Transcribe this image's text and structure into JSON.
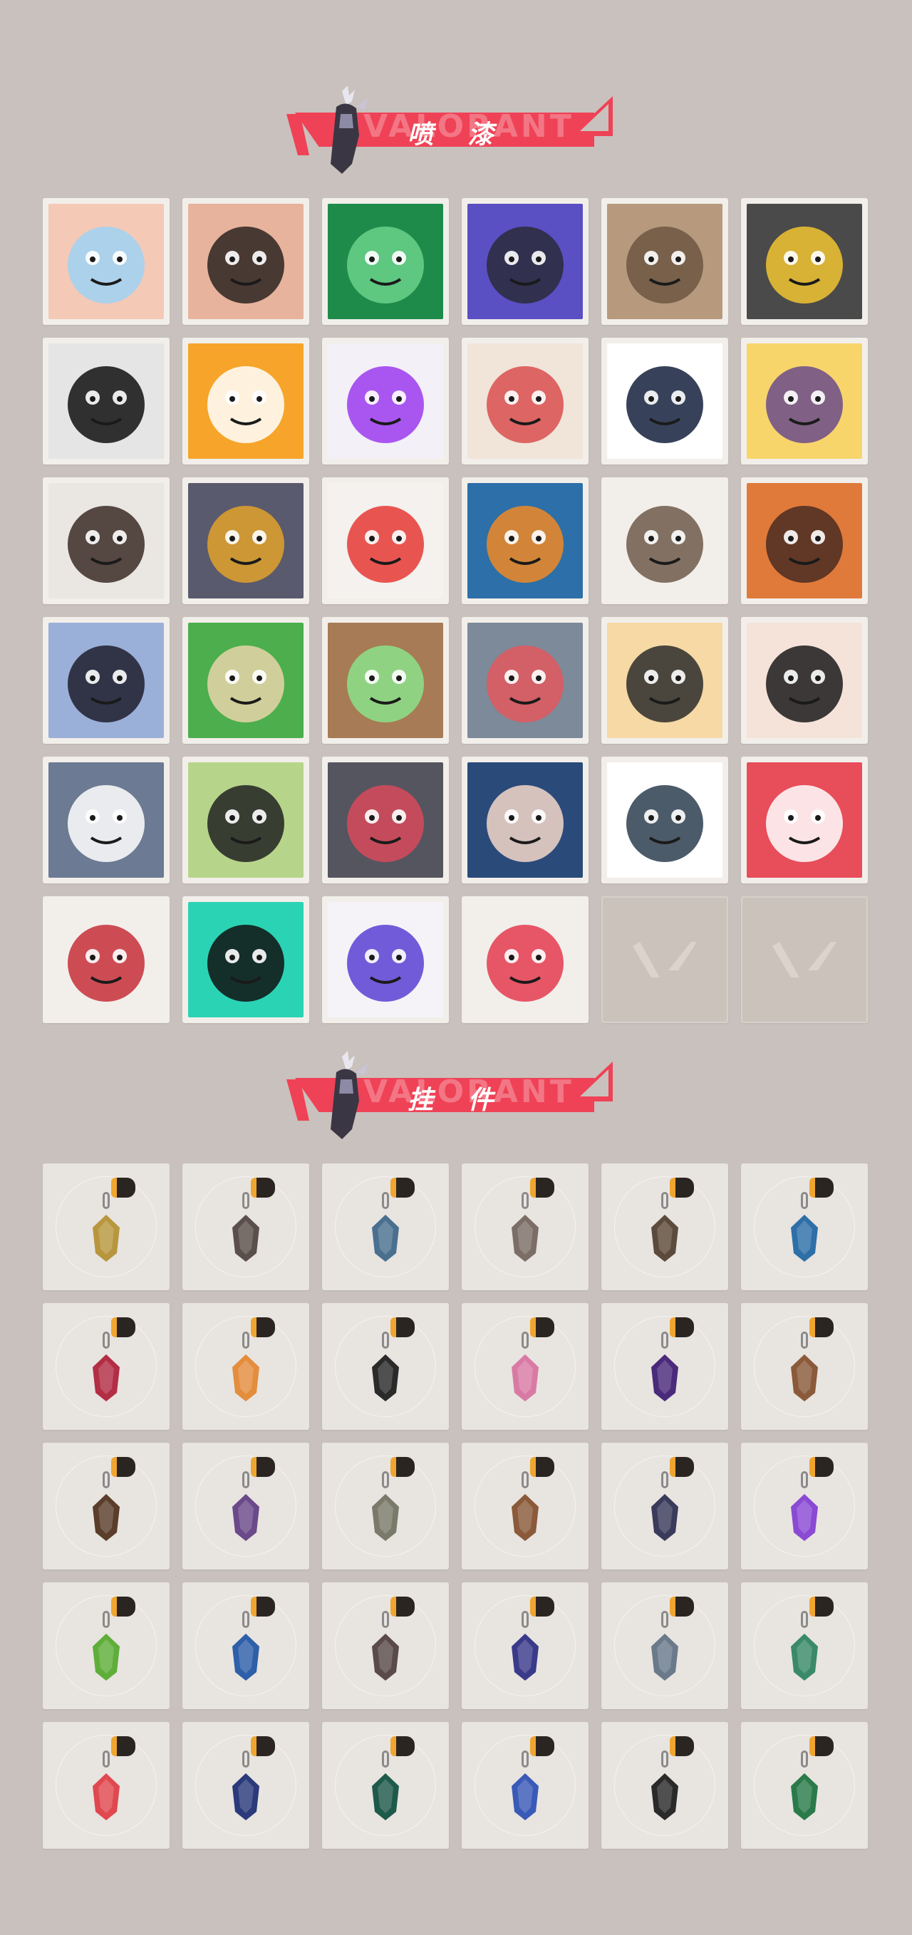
{
  "sections": {
    "sprays": {
      "title": "喷 漆",
      "watermark": "VALORANT"
    },
    "charms": {
      "title": "挂 件",
      "watermark": "VALORANT"
    }
  },
  "spray_tiles": [
    {
      "name": "butterfly-face-spray",
      "bg": "#f4c9b6",
      "accent": "#9fd2f5"
    },
    {
      "name": "angry-face-spray",
      "bg": "#e7b39c",
      "accent": "#2b2320"
    },
    {
      "name": "green-mask-spray",
      "bg": "#1e8b4b",
      "accent": "#6ad18a"
    },
    {
      "name": "purple-gun-spray",
      "bg": "#5b4fc4",
      "accent": "#2a2a3a"
    },
    {
      "name": "penguin-hat-spray",
      "bg": "#b79a7e",
      "accent": "#6d5641"
    },
    {
      "name": "robot-eye-spray",
      "bg": "#4a4a4a",
      "accent": "#f1c431"
    },
    {
      "name": "sparkle-star-spray",
      "bg": "#e5e5e5",
      "accent": "#111111"
    },
    {
      "name": "orange-mask-spray",
      "bg": "#f6a52a",
      "accent": "#ffffff"
    },
    {
      "name": "purple-scribble-spray",
      "bg": "#f3f0f7",
      "accent": "#9b3bef"
    },
    {
      "name": "goggles-cat-spray",
      "bg": "#f1e4d8",
      "accent": "#d94f4f"
    },
    {
      "name": "chevron-stripes-spray",
      "bg": "#ffffff",
      "accent": "#14213d"
    },
    {
      "name": "yellow-blob-spray",
      "bg": "#f7d56b",
      "accent": "#6b4b8a"
    },
    {
      "name": "pixel-character-spray",
      "bg": "#eae6e2",
      "accent": "#3b2a24"
    },
    {
      "name": "armored-helmet-spray",
      "bg": "#5a5a6e",
      "accent": "#e0a22a"
    },
    {
      "name": "clown-face-spray",
      "bg": "#f4f1ee",
      "accent": "#e53935"
    },
    {
      "name": "orange-dial-spray",
      "bg": "#2d6fa8",
      "accent": "#f08a24"
    },
    {
      "name": "raccoon-spray",
      "bg": "#f2efeb",
      "accent": "#6f5a4a"
    },
    {
      "name": "bearded-man-spray",
      "bg": "#e07a3a",
      "accent": "#4a2c22"
    },
    {
      "name": "dark-hair-boy-spray",
      "bg": "#9bb0d8",
      "accent": "#1e1e2e"
    },
    {
      "name": "green-crate-spray",
      "bg": "#4cae4c",
      "accent": "#e8d5a9"
    },
    {
      "name": "green-eyes-spray",
      "bg": "#a77b55",
      "accent": "#8be38b"
    },
    {
      "name": "crying-creature-spray",
      "bg": "#7d8a99",
      "accent": "#e2575e"
    },
    {
      "name": "tiger-spray",
      "bg": "#f6d9a4",
      "accent": "#2b2b2b"
    },
    {
      "name": "black-hair-girl-spray",
      "bg": "#f5e3da",
      "accent": "#1a1a1a"
    },
    {
      "name": "beanie-penguin-spray",
      "bg": "#6c7a93",
      "accent": "#ffffff"
    },
    {
      "name": "frog-hat-spray",
      "bg": "#b7d58a",
      "accent": "#222222"
    },
    {
      "name": "grinning-cat-spray",
      "bg": "#55555f",
      "accent": "#d84a5a"
    },
    {
      "name": "hooded-girl-spray",
      "bg": "#2a4a7a",
      "accent": "#f3d7c9"
    },
    {
      "name": "pixel-raccoon-gun-spray",
      "bg": "#ffffff",
      "accent": "#2d3e50"
    },
    {
      "name": "red-number-spray",
      "bg": "#e84d5a",
      "accent": "#ffffff"
    },
    {
      "name": "red-x-spray",
      "bg": "#f2efeb",
      "accent": "#c72f3a"
    },
    {
      "name": "teal-valorant-spray",
      "bg": "#2bd3b5",
      "accent": "#111111"
    },
    {
      "name": "purple-graffiti-spray",
      "bg": "#f5f3f8",
      "accent": "#5a3fd3"
    },
    {
      "name": "red-circle-logo-spray",
      "bg": "#f2efeb",
      "accent": "#e53b4f"
    },
    {
      "name": "empty-slot-1",
      "bg": "#cbc2bb",
      "accent": "#dcd3cc",
      "empty": true
    },
    {
      "name": "empty-slot-2",
      "bg": "#cbc2bb",
      "accent": "#dcd3cc",
      "empty": true
    }
  ],
  "charm_tiles": [
    {
      "name": "gold-bear-charm",
      "color": "#b8963d"
    },
    {
      "name": "robot-orb-charm",
      "color": "#5a4f4a"
    },
    {
      "name": "blue-box-charm",
      "color": "#4a6f8f"
    },
    {
      "name": "raccoon-charm",
      "color": "#7c6e66"
    },
    {
      "name": "round-bag-charm",
      "color": "#5c4a3a"
    },
    {
      "name": "blue-bottle-charm",
      "color": "#2e6fa8"
    },
    {
      "name": "red-spike-charm",
      "color": "#b32d45"
    },
    {
      "name": "orange-fish-charm",
      "color": "#e38d3d"
    },
    {
      "name": "black-rope-charm",
      "color": "#2a2a2a"
    },
    {
      "name": "pink-cupcake-charm",
      "color": "#d97aa5"
    },
    {
      "name": "ep9-purple-charm",
      "color": "#4a2a7a"
    },
    {
      "name": "teddy-bear-charm",
      "color": "#8a5a3a"
    },
    {
      "name": "brown-cross-charm",
      "color": "#5a3d2a"
    },
    {
      "name": "mini-agent-charm",
      "color": "#6b4a8a"
    },
    {
      "name": "gray-hat-charm",
      "color": "#7a7a6a"
    },
    {
      "name": "brown-box-charm",
      "color": "#8a5a3a"
    },
    {
      "name": "tassel-charm",
      "color": "#3a3a5a"
    },
    {
      "name": "lava-lamp-charm",
      "color": "#8a4ad3"
    },
    {
      "name": "green-pager-charm",
      "color": "#5fae3a"
    },
    {
      "name": "blue-astronaut-charm",
      "color": "#2e5fa8"
    },
    {
      "name": "radio-charm",
      "color": "#5a4a4a"
    },
    {
      "name": "ep9-blue-charm",
      "color": "#3a3a8a"
    },
    {
      "name": "agent-badge-charm",
      "color": "#6a7a8a"
    },
    {
      "name": "green-robot-charm",
      "color": "#3a8a6a"
    },
    {
      "name": "watermelon-charm",
      "color": "#e0484f"
    },
    {
      "name": "ep9-gold-charm",
      "color": "#2a3a7a"
    },
    {
      "name": "ep8-green-charm",
      "color": "#1e5a4a"
    },
    {
      "name": "ufo-charm",
      "color": "#3a5ab8"
    },
    {
      "name": "gold-v-charm",
      "color": "#2a2a2a"
    },
    {
      "name": "green-gem-charm",
      "color": "#2a7a4a"
    }
  ]
}
